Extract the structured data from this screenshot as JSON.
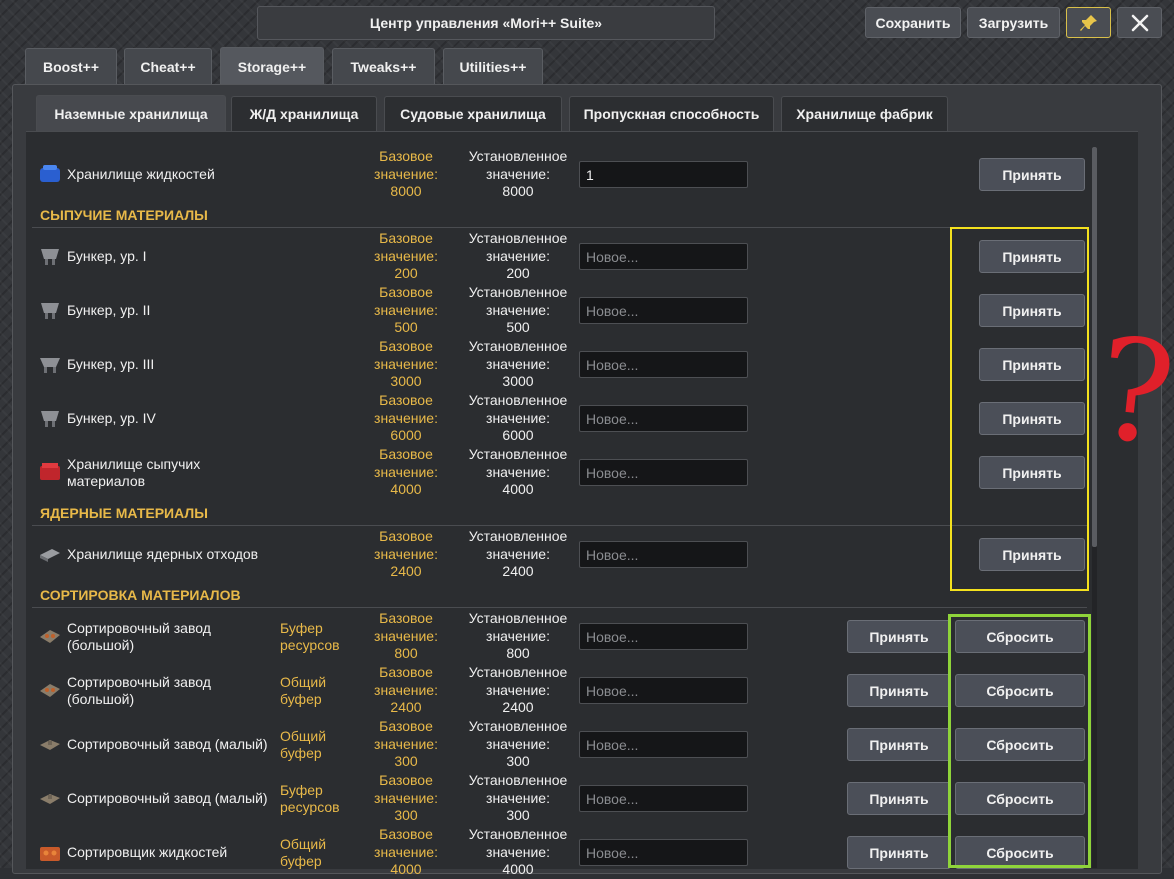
{
  "window": {
    "title": "Центр управления «Mori++ Suite»",
    "save_label": "Сохранить",
    "load_label": "Загрузить",
    "pin_icon": "pin-icon",
    "close_icon": "close-icon"
  },
  "main_tabs": [
    {
      "label": "Boost++"
    },
    {
      "label": "Cheat++"
    },
    {
      "label": "Storage++",
      "active": true
    },
    {
      "label": "Tweaks++"
    },
    {
      "label": "Utilities++"
    }
  ],
  "sub_tabs": [
    {
      "label": "Наземные хранилища",
      "active": true
    },
    {
      "label": "Ж/Д хранилища"
    },
    {
      "label": "Судовые хранилища"
    },
    {
      "label": "Пропускная способность"
    },
    {
      "label": "Хранилище фабрик"
    }
  ],
  "common": {
    "base_label": "Базовое значение:",
    "set_label": "Установленное значение:",
    "input_placeholder": "Новое...",
    "accept_label": "Принять",
    "reset_label": "Сбросить"
  },
  "rows": {
    "liquid": {
      "name": "Хранилище жидкостей",
      "base": "8000",
      "set": "8000",
      "input_value": "1"
    },
    "bulk_section": "СЫПУЧИЕ МАТЕРИАЛЫ",
    "bunker1": {
      "name": "Бункер, ур. I",
      "base": "200",
      "set": "200"
    },
    "bunker2": {
      "name": "Бункер, ур. II",
      "base": "500",
      "set": "500"
    },
    "bunker3": {
      "name": "Бункер, ур. III",
      "base": "3000",
      "set": "3000"
    },
    "bunker4": {
      "name": "Бункер, ур. IV",
      "base": "6000",
      "set": "6000"
    },
    "bulkstore": {
      "name": "Хранилище сыпучих материалов",
      "base": "4000",
      "set": "4000"
    },
    "nuclear_section": "ЯДЕРНЫЕ МАТЕРИАЛЫ",
    "nuclear": {
      "name": "Хранилище ядерных отходов",
      "base": "2400",
      "set": "2400"
    },
    "sort_section": "СОРТИРОВКА МАТЕРИАЛОВ",
    "sort1": {
      "name": "Сортировочный завод (большой)",
      "buffer": "Буфер ресурсов",
      "base": "800",
      "set": "800"
    },
    "sort2": {
      "name": "Сортировочный завод (большой)",
      "buffer": "Общий буфер",
      "base": "2400",
      "set": "2400"
    },
    "sort3": {
      "name": "Сортировочный завод (малый)",
      "buffer": "Общий буфер",
      "base": "300",
      "set": "300"
    },
    "sort4": {
      "name": "Сортировочный завод (малый)",
      "buffer": "Буфер ресурсов",
      "base": "300",
      "set": "300"
    },
    "sort5": {
      "name": "Сортировщик жидкостей",
      "buffer": "Общий буфер",
      "base": "4000",
      "set": "4000"
    }
  },
  "annotation": {
    "question_mark": "?"
  },
  "colors": {
    "accent_yellow": "#e8b949",
    "highlight_yellow": "#f4e11e",
    "highlight_green": "#8fd43a",
    "annotation_red": "#e0202a"
  }
}
